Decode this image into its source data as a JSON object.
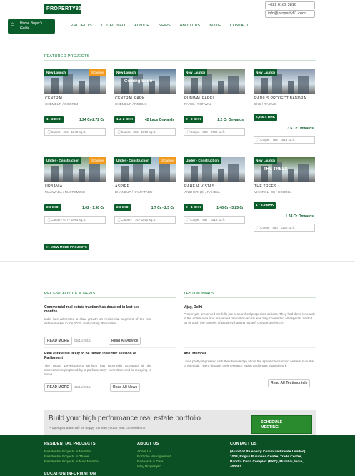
{
  "header": {
    "logo": "PROPERTY81.COM",
    "phone": "+022 6162 3816",
    "email": "info@property81.com",
    "home_line1": "Home Buyer's",
    "home_line2": "Guide",
    "nav": [
      "PROJECTS",
      "LOCAL INFO",
      "ADVICE",
      "NEWS",
      "ABOUT US",
      "BLOG",
      "CONTACT"
    ]
  },
  "featured": {
    "title": "FEATURED PROJECTS",
    "view_more": ">> VIEW MORE PROJECTS",
    "cards": [
      {
        "badge": "New Launch",
        "badge2": "Scheme",
        "name": "CENTRAL",
        "loc": "CHEMBUR / GODREJ",
        "bhk": "1 - 3 BHK",
        "price": "1.24 Cr-2.72 Cr",
        "carpet": "Carpet - 466 - 1048 sq.ft.",
        "img": "#6b8fae"
      },
      {
        "badge": "New Launch",
        "badge2": "",
        "name": "CENTRAL PARK",
        "loc": "CHEMBUR / REDIUS",
        "bhk": "1 & 2 BHK",
        "price": "42 Lacs Onwards",
        "carpet": "Carpet - 365 - 1000 sq.ft.",
        "img": "#5f7f9c",
        "overlay": "Coming Soon"
      },
      {
        "badge": "New Launch",
        "badge2": "",
        "name": "RUNWAL PAREL",
        "loc": "PAREL / RUNWAL",
        "bhk": "2 - 3 BHK",
        "price": "2.2 Cr Onwards",
        "carpet": "Carpet - 930 - 2730 sq.ft.",
        "img": "#7c8c7a"
      },
      {
        "badge": "New Launch",
        "badge2": "",
        "name": "RADIUS PROJECT BANDRA",
        "loc": "BKC / RADIUS",
        "bhk": "2,3 & 4 BHK",
        "price": "3.6 Cr Onwards",
        "carpet": "Carpet - 768 - 1819 sq.ft.",
        "img": "#8a9ab0"
      },
      {
        "badge": "Under - Construction",
        "badge2": "Scheme",
        "name": "URBANIA",
        "loc": "MAJIWADA / RUSTOMJEE",
        "bhk": "2,3 BHK",
        "price": "1.02 - 1.98 Cr",
        "carpet": "Carpet - 677 - 1094 sq.ft.",
        "img": "#7d9b72"
      },
      {
        "badge": "Under - Construction",
        "badge2": "Scheme",
        "name": "ASPIRE",
        "loc": "BHANDUP / KALPATARU",
        "bhk": "2,3 BHK",
        "price": "1.7 Cr - 2.5 Cr",
        "carpet": "Carpet - 775 - 1020 sq.ft.",
        "img": "#9ab4c8"
      },
      {
        "badge": "Under - Construction",
        "badge2": "",
        "name": "RAHEJA VISTAS",
        "loc": "ANDHERI (E) / RAHEJA",
        "bhk": "2 - 4 BHK",
        "price": "1.48 Cr - 3.25 Cr",
        "carpet": "Carpet - 967 - 1516 sq.ft.",
        "img": "#a8b8c6"
      },
      {
        "badge": "New Launch",
        "badge2": "",
        "name": "THE TREES",
        "loc": "VIKHROLI (E) / GODREJ",
        "bhk": "1 - 3.5 BHK",
        "price": "1.24 Cr Onwards",
        "carpet": "Carpet - 480 - 1330 sq.ft.",
        "img": "#5a7a4a",
        "overlay": "THE TREES"
      }
    ]
  },
  "advice": {
    "title": "RECENT ADVICE & NEWS",
    "items": [
      {
        "title": "Commercial real estate traction has doubled in last six months",
        "body": "India has witnessed a slow growth on residential segment of the real estate market in the 2015. Fortunately, the market ...",
        "read_more": "READ MORE",
        "date": "05/11/2015",
        "all": "Read All Advice"
      },
      {
        "title": "Real estate bill likely to be tabled in winter session of Parliament",
        "body": "The Urban Development Ministry has reportedly accepted all the amendments proposed by a parliamentary committee and is readying to move...",
        "read_more": "READ MORE",
        "date": "16/11/2015",
        "all": "Read All News"
      }
    ]
  },
  "testimonials": {
    "title": "TESTIMONIALS",
    "items": [
      {
        "name": "Vijay, Delhi",
        "body": "Property81 presented me fully pre-researched properties options. They had done research in the entire area and presented me option which was fully covered in all aspects. I didn't go through the hassles of property hunting myself. Great experience!!"
      },
      {
        "name": "Anil, Mumbai.",
        "body": "I was pretty impressed with their knowledge about the specific location in eastern suburbs of Mumbai. I went through their research report and it was a good work."
      }
    ],
    "all": "Read All Testimonials"
  },
  "banner": {
    "title": "Build your high performance real estate portfolio",
    "sub": "Property81 team will be happy to meet you at your convenience.",
    "button_line1": "SCHEDULE",
    "button_line2": "MEETING"
  },
  "footer": {
    "res_title": "RESIDENTIAL PROJECTS",
    "res_links": [
      "Residential Projects in Mumbai",
      "Residential Projects in Thane",
      "Residential Projects in Navi Mumbai"
    ],
    "loc_title": "LOCATION INFORMATION",
    "about_title": "ABOUT US",
    "about_links": [
      "About Us",
      "Portfolio Management",
      "Research & Data",
      "Why Property81"
    ],
    "contact_title": "CONTACT US",
    "contact_lines": [
      "(A unit of Blueberry Commute Private Limited)",
      "1008, Rogus Business Centre, Trade Centre,",
      "Bandra Kurla Complex (BKC), Mumbai, India,",
      "400051."
    ]
  },
  "colors": {
    "brand": "#0a5d2a",
    "accent": "#f29a1e",
    "footer": "#0b4f24"
  }
}
